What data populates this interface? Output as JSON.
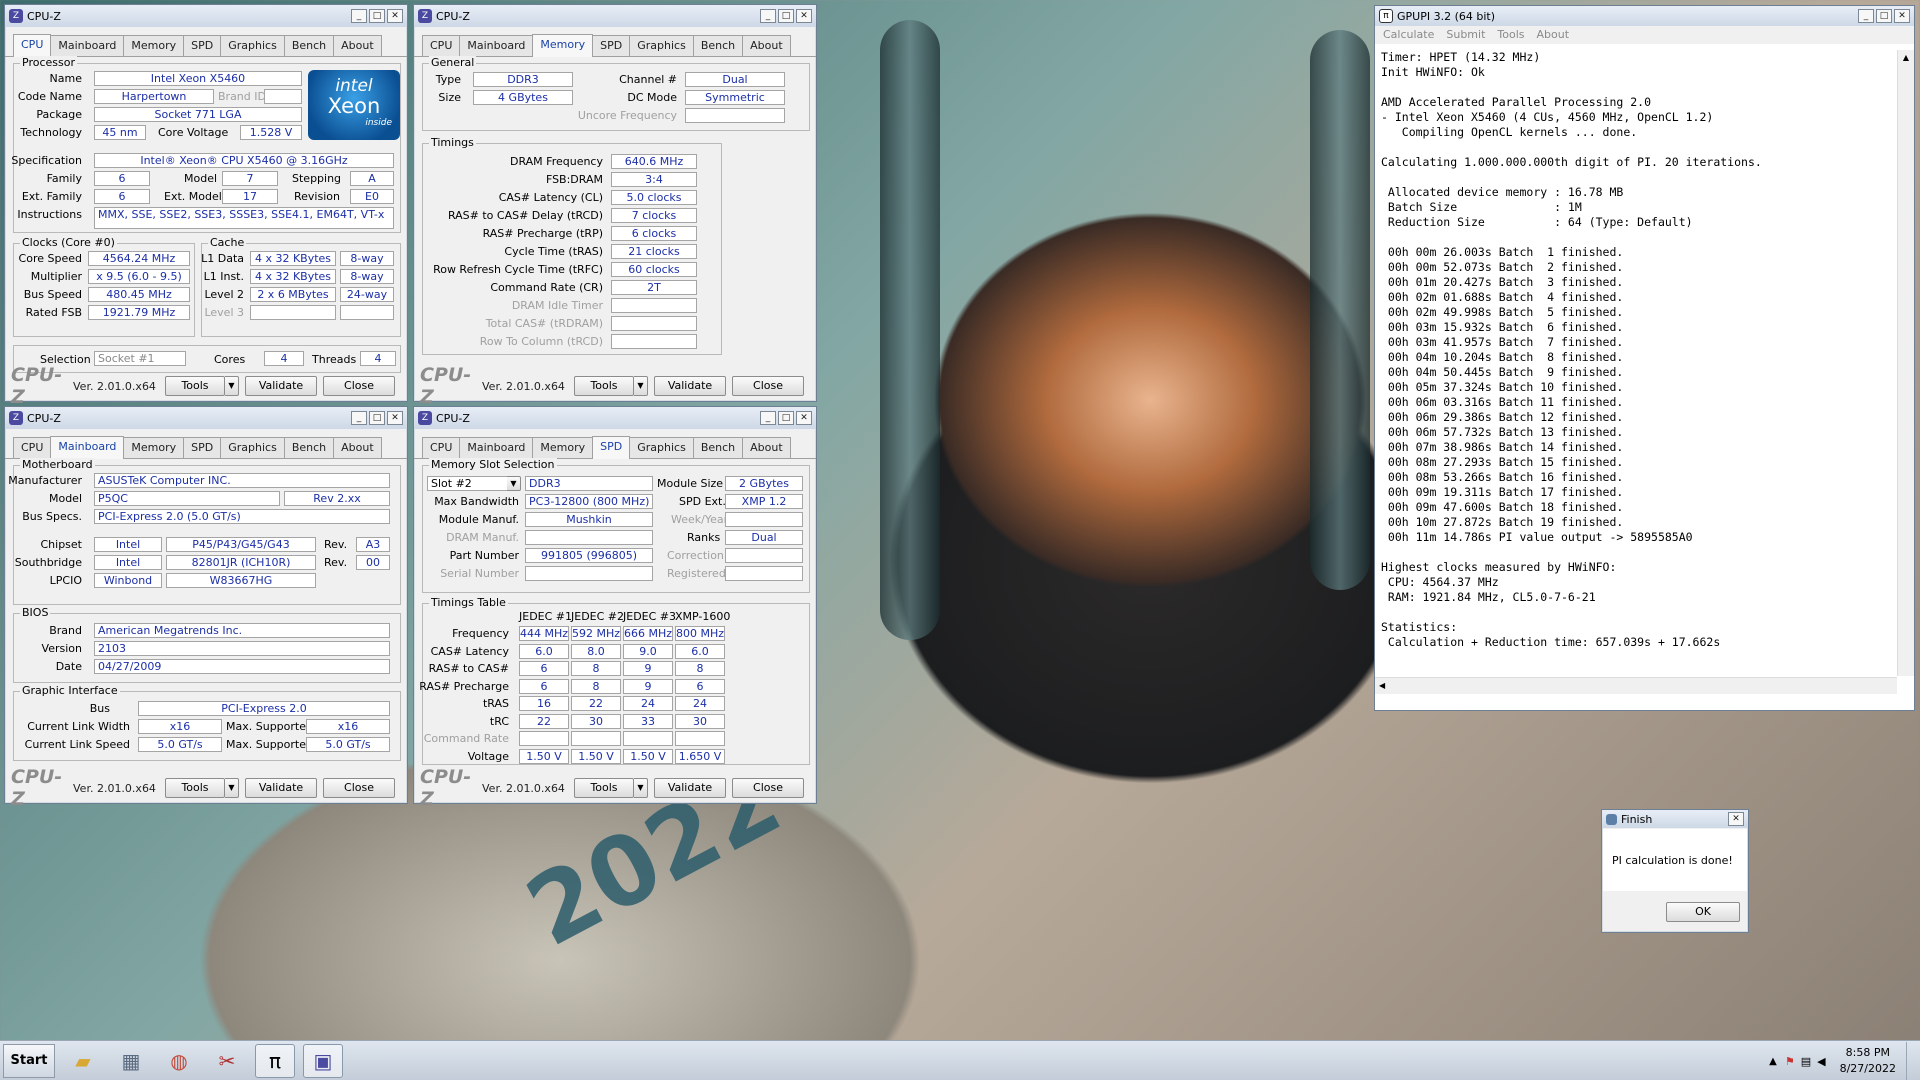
{
  "cpuz_title": "CPU-Z",
  "cpuz_tabs": [
    "CPU",
    "Mainboard",
    "Memory",
    "SPD",
    "Graphics",
    "Bench",
    "About"
  ],
  "cpuz_bottom": {
    "logo": "CPU-Z",
    "version": "Ver. 2.01.0.x64",
    "tools": "Tools",
    "validate": "Validate",
    "close": "Close"
  },
  "cpu": {
    "processor_group": "Processor",
    "name_label": "Name",
    "name": "Intel Xeon X5460",
    "codename_label": "Code Name",
    "codename": "Harpertown",
    "brandid_label": "Brand ID",
    "package_label": "Package",
    "package": "Socket 771 LGA",
    "tech_label": "Technology",
    "tech": "45 nm",
    "voltage_label": "Core Voltage",
    "voltage": "1.528 V",
    "spec_label": "Specification",
    "spec": "Intel® Xeon® CPU          X5460  @ 3.16GHz",
    "family_label": "Family",
    "family": "6",
    "model_label": "Model",
    "model": "7",
    "stepping_label": "Stepping",
    "stepping": "A",
    "extfamily_label": "Ext. Family",
    "extfamily": "6",
    "extmodel_label": "Ext. Model",
    "extmodel": "17",
    "revision_label": "Revision",
    "revision": "E0",
    "instr_label": "Instructions",
    "instr": "MMX, SSE, SSE2, SSE3, SSSE3, SSE4.1, EM64T, VT-x",
    "clocks_group": "Clocks (Core #0)",
    "corespeed_label": "Core Speed",
    "corespeed": "4564.24 MHz",
    "multiplier_label": "Multiplier",
    "multiplier": "x 9.5 (6.0 - 9.5)",
    "busspeed_label": "Bus Speed",
    "busspeed": "480.45 MHz",
    "ratedfsb_label": "Rated FSB",
    "ratedfsb": "1921.79 MHz",
    "cache_group": "Cache",
    "l1d_label": "L1 Data",
    "l1d": "4 x 32 KBytes",
    "l1d_way": "8-way",
    "l1i_label": "L1 Inst.",
    "l1i": "4 x 32 KBytes",
    "l1i_way": "8-way",
    "l2_label": "Level 2",
    "l2": "2 x 6 MBytes",
    "l2_way": "24-way",
    "l3_label": "Level 3",
    "selection_label": "Selection",
    "selection": "Socket #1",
    "cores_label": "Cores",
    "cores": "4",
    "threads_label": "Threads",
    "threads": "4",
    "intel_brand": "intel",
    "intel_product": "Xeon",
    "intel_inside": "inside"
  },
  "mem": {
    "general_group": "General",
    "type_label": "Type",
    "type": "DDR3",
    "channel_label": "Channel #",
    "channel": "Dual",
    "size_label": "Size",
    "size": "4 GBytes",
    "dcmode_label": "DC Mode",
    "dcmode": "Symmetric",
    "uncore_label": "Uncore Frequency",
    "timings_group": "Timings",
    "rows": [
      {
        "l": "DRAM Frequency",
        "v": "640.6 MHz"
      },
      {
        "l": "FSB:DRAM",
        "v": "3:4"
      },
      {
        "l": "CAS# Latency (CL)",
        "v": "5.0 clocks"
      },
      {
        "l": "RAS# to CAS# Delay (tRCD)",
        "v": "7 clocks"
      },
      {
        "l": "RAS# Precharge (tRP)",
        "v": "6 clocks"
      },
      {
        "l": "Cycle Time (tRAS)",
        "v": "21 clocks"
      },
      {
        "l": "Row Refresh Cycle Time (tRFC)",
        "v": "60 clocks"
      },
      {
        "l": "Command Rate (CR)",
        "v": "2T"
      },
      {
        "l": "DRAM Idle Timer",
        "v": ""
      },
      {
        "l": "Total CAS# (tRDRAM)",
        "v": ""
      },
      {
        "l": "Row To Column (tRCD)",
        "v": ""
      }
    ]
  },
  "mb": {
    "motherboard_group": "Motherboard",
    "manufacturer_label": "Manufacturer",
    "manufacturer": "ASUSTeK Computer INC.",
    "model_label": "Model",
    "model": "P5QC",
    "model_rev": "Rev 2.xx",
    "busspecs_label": "Bus Specs.",
    "busspecs": "PCI-Express 2.0 (5.0 GT/s)",
    "chipset_label": "Chipset",
    "chipset_vendor": "Intel",
    "chipset": "P45/P43/G45/G43",
    "chipset_rev_label": "Rev.",
    "chipset_rev": "A3",
    "south_label": "Southbridge",
    "south_vendor": "Intel",
    "south": "82801JR (ICH10R)",
    "south_rev_label": "Rev.",
    "south_rev": "00",
    "lpcio_label": "LPCIO",
    "lpcio_vendor": "Winbond",
    "lpcio": "W83667HG",
    "bios_group": "BIOS",
    "brand_label": "Brand",
    "brand": "American Megatrends Inc.",
    "version_label": "Version",
    "version": "2103",
    "date_label": "Date",
    "date": "04/27/2009",
    "gi_group": "Graphic Interface",
    "bus_label": "Bus",
    "bus": "PCI-Express 2.0",
    "clw_label": "Current Link Width",
    "clw": "x16",
    "msw_label": "Max. Supported",
    "msw": "x16",
    "cls_label": "Current Link Speed",
    "cls": "5.0 GT/s",
    "mss_label": "Max. Supported",
    "mss": "5.0 GT/s"
  },
  "spd": {
    "slot_group": "Memory Slot Selection",
    "slot": "Slot #2",
    "slot_type": "DDR3",
    "modsize_label": "Module Size",
    "modsize": "2 GBytes",
    "maxbw_label": "Max Bandwidth",
    "maxbw": "PC3-12800 (800 MHz)",
    "spdext_label": "SPD Ext.",
    "spdext": "XMP 1.2",
    "manuf_label": "Module Manuf.",
    "manuf": "Mushkin",
    "week_label": "Week/Year",
    "dramm_label": "DRAM Manuf.",
    "ranks_label": "Ranks",
    "ranks": "Dual",
    "part_label": "Part Number",
    "part": "991805 (996805)",
    "corr_label": "Correction",
    "serial_label": "Serial Number",
    "reg_label": "Registered",
    "tt_group": "Timings Table",
    "cols": [
      "JEDEC #1",
      "JEDEC #2",
      "JEDEC #3",
      "XMP-1600"
    ],
    "rows": [
      {
        "l": "Frequency",
        "v": [
          "444 MHz",
          "592 MHz",
          "666 MHz",
          "800 MHz"
        ]
      },
      {
        "l": "CAS# Latency",
        "v": [
          "6.0",
          "8.0",
          "9.0",
          "6.0"
        ]
      },
      {
        "l": "RAS# to CAS#",
        "v": [
          "6",
          "8",
          "9",
          "8"
        ]
      },
      {
        "l": "RAS# Precharge",
        "v": [
          "6",
          "8",
          "9",
          "6"
        ]
      },
      {
        "l": "tRAS",
        "v": [
          "16",
          "22",
          "24",
          "24"
        ]
      },
      {
        "l": "tRC",
        "v": [
          "22",
          "30",
          "33",
          "30"
        ]
      },
      {
        "l": "Command Rate",
        "v": [
          "",
          "",
          "",
          ""
        ]
      },
      {
        "l": "Voltage",
        "v": [
          "1.50 V",
          "1.50 V",
          "1.50 V",
          "1.650 V"
        ]
      }
    ]
  },
  "gpupi": {
    "title": "GPUPI 3.2 (64 bit)",
    "menu": [
      "Calculate",
      "Submit",
      "Tools",
      "About"
    ],
    "log": "Timer: HPET (14.32 MHz)\nInit HWiNFO: Ok\n\nAMD Accelerated Parallel Processing 2.0\n- Intel Xeon X5460 (4 CUs, 4560 MHz, OpenCL 1.2)\n   Compiling OpenCL kernels ... done.\n\nCalculating 1.000.000.000th digit of PI. 20 iterations.\n\n Allocated device memory : 16.78 MB\n Batch Size              : 1M\n Reduction Size          : 64 (Type: Default)\n\n 00h 00m 26.003s Batch  1 finished.\n 00h 00m 52.073s Batch  2 finished.\n 00h 01m 20.427s Batch  3 finished.\n 00h 02m 01.688s Batch  4 finished.\n 00h 02m 49.998s Batch  5 finished.\n 00h 03m 15.932s Batch  6 finished.\n 00h 03m 41.957s Batch  7 finished.\n 00h 04m 10.204s Batch  8 finished.\n 00h 04m 50.445s Batch  9 finished.\n 00h 05m 37.324s Batch 10 finished.\n 00h 06m 03.316s Batch 11 finished.\n 00h 06m 29.386s Batch 12 finished.\n 00h 06m 57.732s Batch 13 finished.\n 00h 07m 38.986s Batch 14 finished.\n 00h 08m 27.293s Batch 15 finished.\n 00h 08m 53.266s Batch 16 finished.\n 00h 09m 19.311s Batch 17 finished.\n 00h 09m 47.600s Batch 18 finished.\n 00h 10m 27.872s Batch 19 finished.\n 00h 11m 14.786s PI value output -> 5895585A0\n\nHighest clocks measured by HWiNFO:\n CPU: 4564.37 MHz\n RAM: 1921.84 MHz, CL5.0-7-6-21\n\nStatistics:\n Calculation + Reduction time: 657.039s + 17.662s"
  },
  "finish": {
    "title": "Finish",
    "message": "PI calculation is done!",
    "ok": "OK"
  },
  "desktop_art": "2022",
  "taskbar": {
    "start": "Start",
    "time": "8:58 PM",
    "date": "8/27/2022"
  }
}
